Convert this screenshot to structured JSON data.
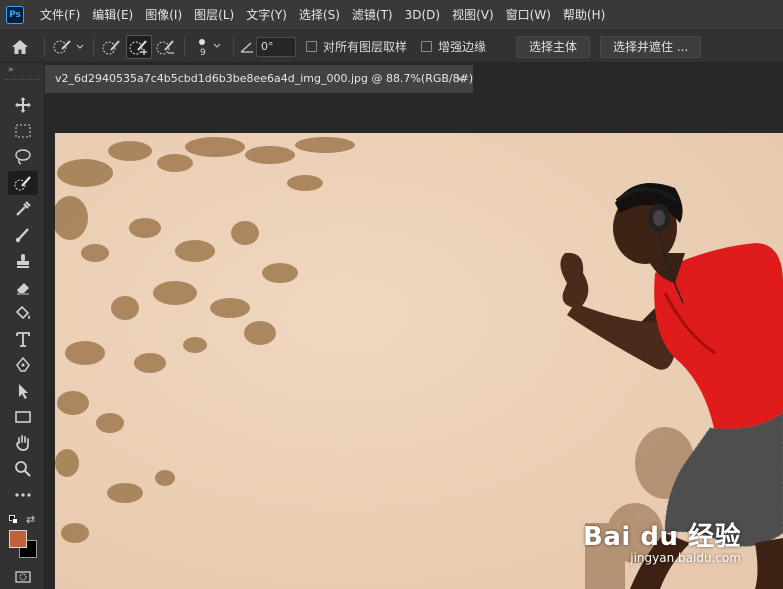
{
  "app": {
    "logo_text": "Ps"
  },
  "menu": [
    "文件(F)",
    "编辑(E)",
    "图像(I)",
    "图层(L)",
    "文字(Y)",
    "选择(S)",
    "滤镜(T)",
    "3D(D)",
    "视图(V)",
    "窗口(W)",
    "帮助(H)"
  ],
  "options": {
    "brush_size": "9",
    "angle": "0°",
    "sample_all_layers_label": "对所有图层取样",
    "sample_all_layers_checked": false,
    "auto_enhance_label": "增强边缘",
    "auto_enhance_checked": false,
    "select_subject_label": "选择主体",
    "select_and_mask_label": "选择并遮住 ..."
  },
  "document": {
    "tab_title": "v2_6d2940535a7c4b5cbd1d6b3be8ee6a4d_img_000.jpg @ 88.7%(RGB/8#)",
    "close_symbol": "×"
  },
  "colors": {
    "foreground": "#c0613a",
    "background": "#000000",
    "canvas_wall": "#ecd2ba",
    "shirt": "#e01b1b"
  },
  "watermark": {
    "main": "Bai du 经验",
    "sub": "jingyan.baidu.com"
  }
}
